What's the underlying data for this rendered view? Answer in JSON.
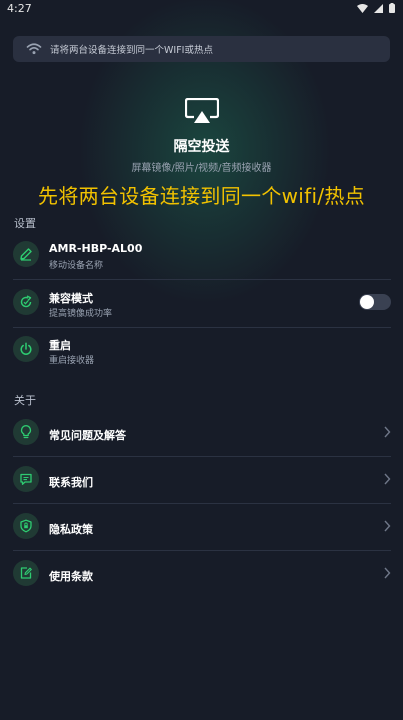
{
  "status_bar": {
    "time": "4:27"
  },
  "banner": {
    "text": "请将两台设备连接到同一个WIFI或热点"
  },
  "hero": {
    "title": "隔空投送",
    "subtitle": "屏幕镜像/照片/视频/音频接收器",
    "caption": "先将两台设备连接到同一个wifi/热点"
  },
  "settings": {
    "label": "设置",
    "device": {
      "title": "AMR-HBP-AL00",
      "desc": "移动设备名称"
    },
    "compat": {
      "title": "兼容模式",
      "desc": "提高镜像成功率",
      "enabled": false
    },
    "restart": {
      "title": "重启",
      "desc": "重启接收器"
    }
  },
  "about": {
    "label": "关于",
    "items": [
      {
        "label": "常见问题及解答",
        "icon": "lightbulb-icon"
      },
      {
        "label": "联系我们",
        "icon": "message-icon"
      },
      {
        "label": "隐私政策",
        "icon": "shield-icon"
      },
      {
        "label": "使用条款",
        "icon": "edit-document-icon"
      }
    ]
  },
  "colors": {
    "accent": "#2ecc71",
    "caption": "#f2c200",
    "background": "#171c28"
  }
}
